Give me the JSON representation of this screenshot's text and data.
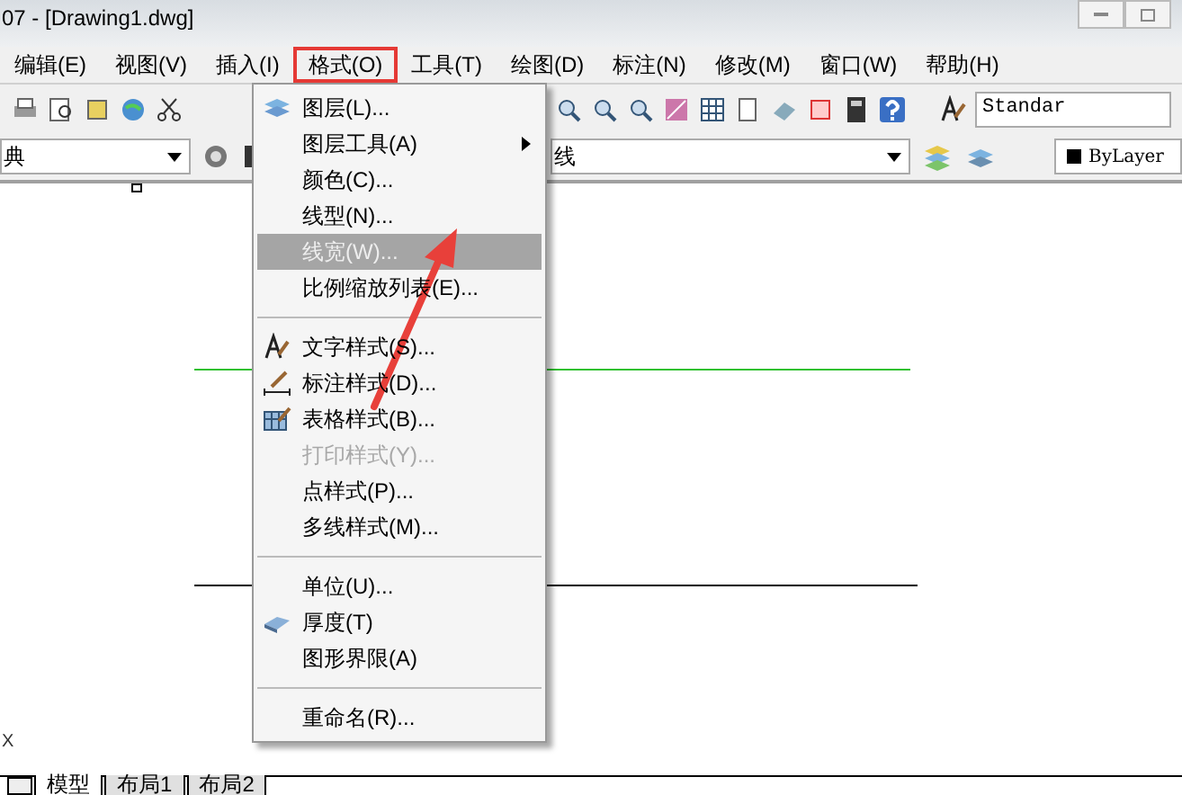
{
  "window": {
    "title": "07 - [Drawing1.dwg]"
  },
  "menu_bar": [
    {
      "label": "编辑(E)",
      "selected": false
    },
    {
      "label": "视图(V)",
      "selected": false
    },
    {
      "label": "插入(I)",
      "selected": false
    },
    {
      "label": "格式(O)",
      "selected": true
    },
    {
      "label": "工具(T)",
      "selected": false
    },
    {
      "label": "绘图(D)",
      "selected": false
    },
    {
      "label": "标注(N)",
      "selected": false
    },
    {
      "label": "修改(M)",
      "selected": false
    },
    {
      "label": "窗口(W)",
      "selected": false
    },
    {
      "label": "帮助(H)",
      "selected": false
    }
  ],
  "toolbar": {
    "text_style_field": "Standar"
  },
  "properties_bar": {
    "style_dropdown": "典",
    "linetype_dropdown": "线",
    "color_field": "ByLayer"
  },
  "format_menu": [
    {
      "kind": "item",
      "label": "图层(L)...",
      "selected": false,
      "disabled": false,
      "submenu": false
    },
    {
      "kind": "item",
      "label": "图层工具(A)",
      "selected": false,
      "disabled": false,
      "submenu": true
    },
    {
      "kind": "item",
      "label": "颜色(C)...",
      "selected": false,
      "disabled": false,
      "submenu": false
    },
    {
      "kind": "item",
      "label": "线型(N)...",
      "selected": false,
      "disabled": false,
      "submenu": false
    },
    {
      "kind": "item",
      "label": "线宽(W)...",
      "selected": true,
      "disabled": false,
      "submenu": false
    },
    {
      "kind": "item",
      "label": "比例缩放列表(E)...",
      "selected": false,
      "disabled": false,
      "submenu": false
    },
    {
      "kind": "separator"
    },
    {
      "kind": "item",
      "label": "文字样式(S)...",
      "selected": false,
      "disabled": false,
      "submenu": false
    },
    {
      "kind": "item",
      "label": "标注样式(D)...",
      "selected": false,
      "disabled": false,
      "submenu": false
    },
    {
      "kind": "item",
      "label": "表格样式(B)...",
      "selected": false,
      "disabled": false,
      "submenu": false
    },
    {
      "kind": "item",
      "label": "打印样式(Y)...",
      "selected": false,
      "disabled": true,
      "submenu": false
    },
    {
      "kind": "item",
      "label": "点样式(P)...",
      "selected": false,
      "disabled": false,
      "submenu": false
    },
    {
      "kind": "item",
      "label": "多线样式(M)...",
      "selected": false,
      "disabled": false,
      "submenu": false
    },
    {
      "kind": "separator"
    },
    {
      "kind": "item",
      "label": "单位(U)...",
      "selected": false,
      "disabled": false,
      "submenu": false
    },
    {
      "kind": "item",
      "label": "厚度(T)",
      "selected": false,
      "disabled": false,
      "submenu": false
    },
    {
      "kind": "item",
      "label": "图形界限(A)",
      "selected": false,
      "disabled": false,
      "submenu": false
    },
    {
      "kind": "separator"
    },
    {
      "kind": "item",
      "label": "重命名(R)...",
      "selected": false,
      "disabled": false,
      "submenu": false
    }
  ],
  "command_line": "X",
  "layout_tabs": [
    {
      "label": "模型",
      "selected": true
    },
    {
      "label": "布局1",
      "selected": false
    },
    {
      "label": "布局2",
      "selected": false
    }
  ]
}
